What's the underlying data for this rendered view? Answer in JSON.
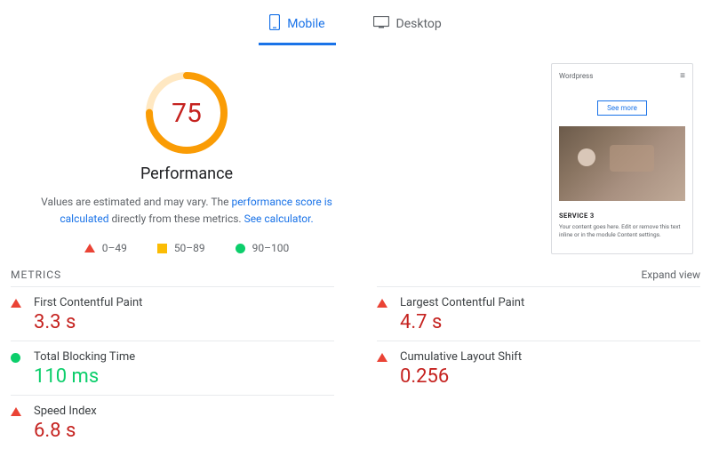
{
  "tabs": {
    "mobile": "Mobile",
    "desktop": "Desktop",
    "active": "mobile"
  },
  "gauge": {
    "score": "75",
    "label": "Performance",
    "desc_prefix": "Values are estimated and may vary. The ",
    "desc_link1": "performance score is calculated",
    "desc_mid": " directly from these metrics. ",
    "desc_link2": "See calculator.",
    "colors": {
      "ok": "#fa9c05",
      "track": "#ffe8c2"
    }
  },
  "legend": {
    "poor": "0–49",
    "ok": "50–89",
    "good": "90–100"
  },
  "preview": {
    "title": "Wordpress",
    "button": "See more",
    "section": "SERVICE 3",
    "desc": "Your content goes here. Edit or remove this text inline or in the module Content settings."
  },
  "metrics_header": "METRICS",
  "expand": "Expand view",
  "metrics": [
    {
      "name": "First Contentful Paint",
      "value": "3.3 s",
      "status": "red"
    },
    {
      "name": "Largest Contentful Paint",
      "value": "4.7 s",
      "status": "red"
    },
    {
      "name": "Total Blocking Time",
      "value": "110 ms",
      "status": "green"
    },
    {
      "name": "Cumulative Layout Shift",
      "value": "0.256",
      "status": "red"
    },
    {
      "name": "Speed Index",
      "value": "6.8 s",
      "status": "red"
    }
  ],
  "chart_data": {
    "type": "bar",
    "title": "Performance",
    "categories": [
      "Performance"
    ],
    "values": [
      75
    ],
    "ylim": [
      0,
      100
    ]
  }
}
